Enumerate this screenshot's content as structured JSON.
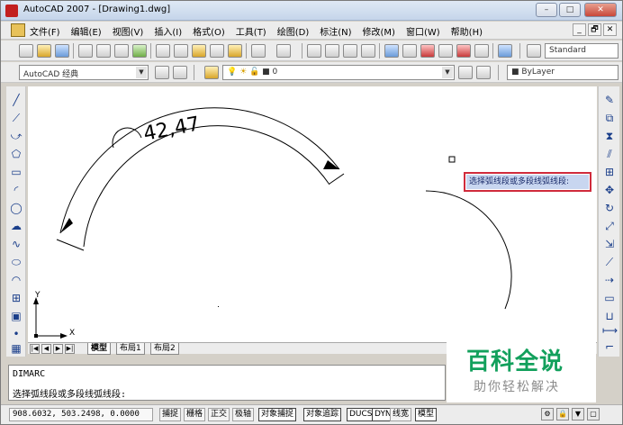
{
  "window": {
    "title": "AutoCAD 2007 - [Drawing1.dwg]",
    "controls": {
      "minimize": "–",
      "maximize": "□",
      "close": "✕"
    },
    "mdi_controls": [
      "_",
      "🗗",
      "✕"
    ]
  },
  "menu": {
    "items": [
      "文件(F)",
      "编辑(E)",
      "视图(V)",
      "插入(I)",
      "格式(O)",
      "工具(T)",
      "绘图(D)",
      "标注(N)",
      "修改(M)",
      "窗口(W)",
      "帮助(H)"
    ]
  },
  "toolbar": {
    "text_style": "Standard",
    "workspace": "AutoCAD 经典",
    "layer": "0",
    "linetype": "ByLayer"
  },
  "drawing": {
    "dimension_text": "42,47",
    "ucs_x": "X",
    "ucs_y": "Y"
  },
  "tooltip": {
    "prompt": "选择弧线段或多段线弧线段:"
  },
  "tabs": {
    "nav": [
      "|◀",
      "◀",
      "▶",
      "▶|"
    ],
    "items": [
      "模型",
      "布局1",
      "布局2"
    ],
    "active": "模型"
  },
  "command": {
    "line1": "DIMARC",
    "line2": "选择弧线段或多段线弧线段:"
  },
  "watermark": {
    "title": "百科全说",
    "subtitle": "助你轻松解决"
  },
  "status": {
    "coords": "908.6032, 503.2498, 0.0000",
    "buttons": [
      "捕捉",
      "栅格",
      "正交",
      "极轴",
      "对象捕捉",
      "对象追踪",
      "DUCS",
      "DYN",
      "线宽",
      "模型"
    ]
  }
}
